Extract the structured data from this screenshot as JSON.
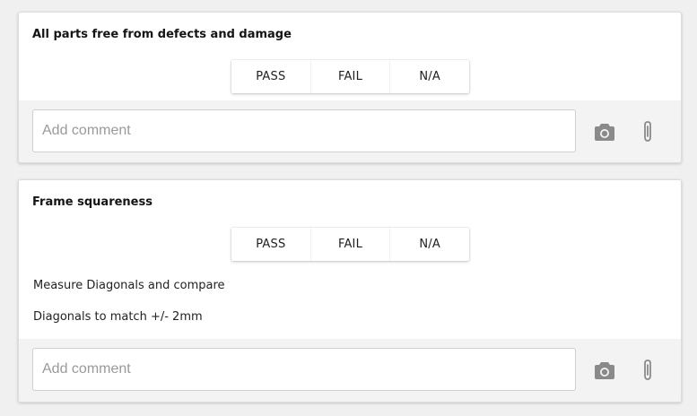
{
  "cards": [
    {
      "title": "All parts free from defects and damage",
      "options": [
        "PASS",
        "FAIL",
        "N/A"
      ],
      "notes": [],
      "comment": {
        "placeholder": "Add comment",
        "value": ""
      },
      "icons": [
        "camera-icon",
        "paperclip-icon"
      ]
    },
    {
      "title": "Frame squareness",
      "options": [
        "PASS",
        "FAIL",
        "N/A"
      ],
      "notes": [
        "Measure Diagonals and compare",
        "Diagonals to match +/- 2mm"
      ],
      "comment": {
        "placeholder": "Add comment",
        "value": ""
      },
      "icons": [
        "camera-icon",
        "paperclip-icon"
      ]
    }
  ],
  "colors": {
    "background": "#f0f0f0",
    "card": "#ffffff",
    "comment_bar": "#f3f3f3",
    "icon": "#8a8a8a",
    "text": "#212121"
  }
}
